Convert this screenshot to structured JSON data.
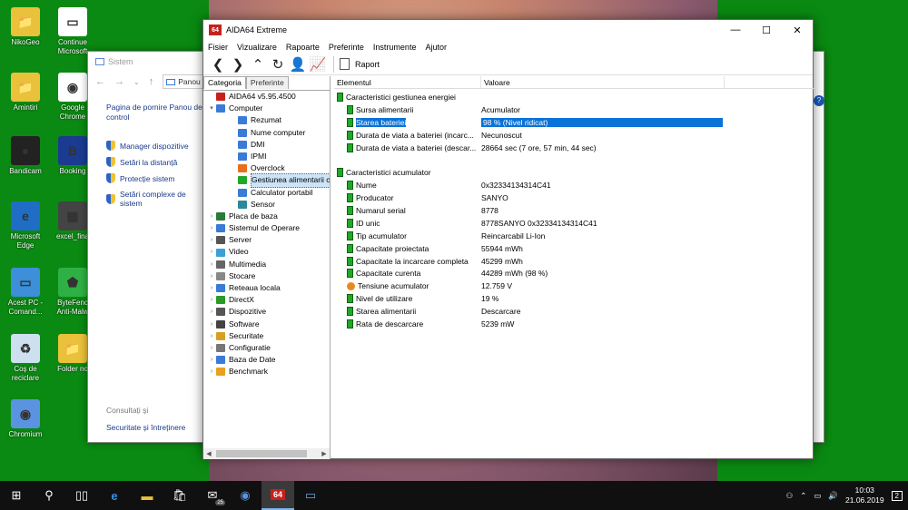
{
  "desktop": {
    "icons": [
      {
        "label": "NikoGeo",
        "color": "#e9c13a",
        "glyph": "📁"
      },
      {
        "label": "Continue\nMicrosoft",
        "color": "#ffffff",
        "glyph": "▭"
      },
      {
        "label": "Amintiri",
        "color": "#e9c13a",
        "glyph": "📁"
      },
      {
        "label": "Google\nChrome",
        "color": "#ffffff",
        "glyph": "◉"
      },
      {
        "label": "Bandicam",
        "color": "#222222",
        "glyph": "●"
      },
      {
        "label": "Booking",
        "color": "#1a3b8f",
        "glyph": "B"
      },
      {
        "label": "Microsoft\nEdge",
        "color": "#1f6dc5",
        "glyph": "e"
      },
      {
        "label": "excel_fina",
        "color": "#444444",
        "glyph": "▦"
      },
      {
        "label": "Acest PC -\nComand...",
        "color": "#3c8fd8",
        "glyph": "▭"
      },
      {
        "label": "ByteFenc\nAnti-Malw",
        "color": "#2fb044",
        "glyph": "⬟"
      },
      {
        "label": "Coș de\nreciclare",
        "color": "#cde0f0",
        "glyph": "♻"
      },
      {
        "label": "Folder no",
        "color": "#e9c13a",
        "glyph": "📁"
      },
      {
        "label": "Chromium",
        "color": "#5a93e0",
        "glyph": "◉"
      }
    ]
  },
  "sistem": {
    "title": "Sistem",
    "address": "Panou",
    "home_link": "Pagina de pornire Panou de control",
    "links": [
      "Manager dispozitive",
      "Setări la distanță",
      "Protecție sistem",
      "Setări complexe de sistem"
    ],
    "see_also": "Consultați și",
    "security_link": "Securitate și întreținere"
  },
  "aida": {
    "title": "AIDA64 Extreme",
    "logo": "64",
    "menu": [
      "Fisier",
      "Vizualizare",
      "Rapoarte",
      "Preferinte",
      "Instrumente",
      "Ajutor"
    ],
    "report_label": "Raport",
    "tabs": {
      "category": "Categoria",
      "favorites": "Preferinte"
    },
    "columns": {
      "element": "Elementul",
      "value": "Valoare"
    },
    "tree": [
      {
        "label": "AIDA64 v5.95.4500",
        "level": 0,
        "exp": "",
        "color": "#c8201c"
      },
      {
        "label": "Computer",
        "level": 0,
        "exp": "▾",
        "color": "#3a7bd5"
      },
      {
        "label": "Rezumat",
        "level": 1,
        "exp": "",
        "color": "#3a7bd5"
      },
      {
        "label": "Nume computer",
        "level": 1,
        "exp": "",
        "color": "#3a7bd5"
      },
      {
        "label": "DMI",
        "level": 1,
        "exp": "",
        "color": "#3a7bd5"
      },
      {
        "label": "IPMI",
        "level": 1,
        "exp": "",
        "color": "#3a7bd5"
      },
      {
        "label": "Overclock",
        "level": 1,
        "exp": "",
        "color": "#e8701a"
      },
      {
        "label": "Gestiunea alimentarii c",
        "level": 1,
        "exp": "",
        "color": "#22a828",
        "selected": true
      },
      {
        "label": "Calculator portabil",
        "level": 1,
        "exp": "",
        "color": "#3a7bd5"
      },
      {
        "label": "Sensor",
        "level": 1,
        "exp": "",
        "color": "#2a8a9a"
      },
      {
        "label": "Placa de baza",
        "level": 0,
        "exp": "›",
        "color": "#2a7a3a"
      },
      {
        "label": "Sistemul de Operare",
        "level": 0,
        "exp": "›",
        "color": "#3a7bd5"
      },
      {
        "label": "Server",
        "level": 0,
        "exp": "›",
        "color": "#555555"
      },
      {
        "label": "Video",
        "level": 0,
        "exp": "›",
        "color": "#3aa0d8"
      },
      {
        "label": "Multimedia",
        "level": 0,
        "exp": "›",
        "color": "#666666"
      },
      {
        "label": "Stocare",
        "level": 0,
        "exp": "›",
        "color": "#888888"
      },
      {
        "label": "Reteaua locala",
        "level": 0,
        "exp": "›",
        "color": "#3a7bd5"
      },
      {
        "label": "DirectX",
        "level": 0,
        "exp": "›",
        "color": "#2a9a2a"
      },
      {
        "label": "Dispozitive",
        "level": 0,
        "exp": "›",
        "color": "#555555"
      },
      {
        "label": "Software",
        "level": 0,
        "exp": "›",
        "color": "#444444"
      },
      {
        "label": "Securitate",
        "level": 0,
        "exp": "›",
        "color": "#d8a020"
      },
      {
        "label": "Configuratie",
        "level": 0,
        "exp": "›",
        "color": "#777777"
      },
      {
        "label": "Baza de Date",
        "level": 0,
        "exp": "›",
        "color": "#3a7bd5"
      },
      {
        "label": "Benchmark",
        "level": 0,
        "exp": "›",
        "color": "#e8a020"
      }
    ],
    "rows": [
      {
        "type": "group",
        "label": "Caracteristici gestiunea energiei",
        "value": ""
      },
      {
        "type": "item",
        "label": "Sursa alimentarii",
        "value": "Acumulator"
      },
      {
        "type": "item",
        "label": "Starea bateriei",
        "value": "98 % (Nivel ridicat)",
        "selected": true
      },
      {
        "type": "item",
        "label": "Durata de viata a bateriei (incarc...",
        "value": "Necunoscut"
      },
      {
        "type": "item",
        "label": "Durata de viata a bateriei (descar...",
        "value": "28664 sec (7 ore, 57 min, 44 sec)"
      },
      {
        "type": "blank",
        "label": "",
        "value": ""
      },
      {
        "type": "group",
        "label": "Caracteristici acumulator",
        "value": ""
      },
      {
        "type": "item",
        "label": "Nume",
        "value": "0x32334134314C41"
      },
      {
        "type": "item",
        "label": "Producator",
        "value": "SANYO"
      },
      {
        "type": "item",
        "label": "Numarul serial",
        "value": "8778"
      },
      {
        "type": "item",
        "label": "ID unic",
        "value": "8778SANYO 0x32334134314C41"
      },
      {
        "type": "item",
        "label": "Tip acumulator",
        "value": "Reincarcabil Li-Ion"
      },
      {
        "type": "item",
        "label": "Capacitate proiectata",
        "value": "55944 mWh"
      },
      {
        "type": "item",
        "label": "Capacitate la incarcare completa",
        "value": "45299 mWh"
      },
      {
        "type": "item",
        "label": "Capacitate curenta",
        "value": "44289 mWh  (98 %)"
      },
      {
        "type": "volt",
        "label": "Tensiune acumulator",
        "value": "12.759 V"
      },
      {
        "type": "item",
        "label": "Nivel de utilizare",
        "value": "19 %"
      },
      {
        "type": "item",
        "label": "Starea alimentarii",
        "value": "Descarcare"
      },
      {
        "type": "item",
        "label": "Rata de descarcare",
        "value": "5239 mW"
      }
    ]
  },
  "taskbar": {
    "mail_badge": "25",
    "aida_label": "64",
    "time": "10:03",
    "date": "21.06.2019",
    "notifications": "2"
  }
}
